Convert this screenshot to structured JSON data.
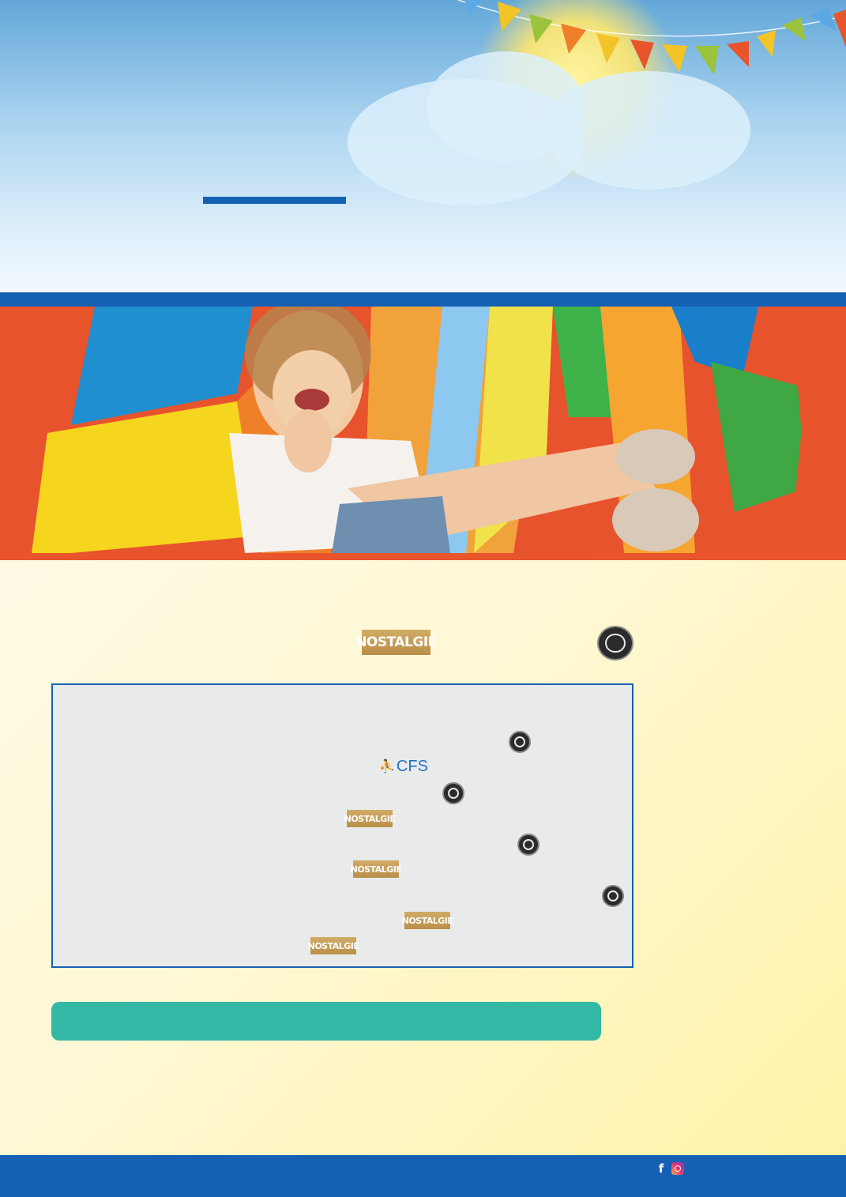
{
  "header": {
    "title_underline_color": "#1660b4"
  },
  "hero": {
    "image": "child-on-inflatable-slide-thumbs-up"
  },
  "sponsors": {
    "nostalgie_text": "NOSTALGIE",
    "cfs_text": "CFS"
  },
  "program": {
    "border_color": "#1660b4",
    "background": "#e9ebea"
  },
  "cta_bar": {
    "color": "#33b8a5"
  },
  "footer": {
    "color": "#1660b4",
    "icons": [
      "facebook-icon",
      "instagram-icon"
    ]
  },
  "colors": {
    "primary_blue": "#1660b4",
    "accent_orange": "#e8542b",
    "teal": "#33b8a5",
    "gold": "#c9a25c"
  }
}
